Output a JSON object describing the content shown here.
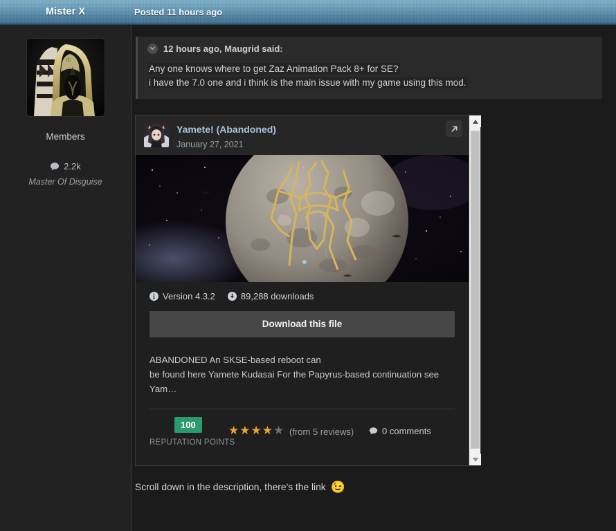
{
  "header": {
    "author": "Mister X",
    "posted": "Posted 11 hours ago"
  },
  "sidebar": {
    "avatar_alt": "hooded-figure-avatar",
    "group": "Members",
    "post_count": "2.2k",
    "post_count_icon": "comment-icon",
    "user_title": "Master Of Disguise"
  },
  "quote": {
    "collapse_icon": "chevron-down-circle-icon",
    "attribution": "12 hours ago, Maugrid said:",
    "line1": "Any one knows where to get Zaz Animation Pack 8+ for SE?",
    "line2": "i have the 7.0 one and i think is the main issue with my game using this mod."
  },
  "embed": {
    "avatar_alt": "anime-character-avatar",
    "title": "Yamete! (Abandoned)",
    "date": "January 27, 2021",
    "external_icon": "external-link-icon",
    "image_alt": "moon-with-gold-line-art",
    "info_icon": "info-circle-icon",
    "version": "Version 4.3.2",
    "download_icon": "download-circle-icon",
    "downloads": "89,288 downloads",
    "download_button": "Download this file",
    "description_line1": "ABANDONED   An SKSE-based reboot can",
    "description_line2": "be found here Yamete Kudasai For the Papyrus-based continuation see Yam…",
    "reputation_points": "100",
    "reputation_label": "REPUTATION POINTS",
    "stars_filled": 4,
    "stars_total": 5,
    "reviews": "(from 5 reviews)",
    "comments_icon": "comment-icon",
    "comments": "0 comments",
    "scrollbar_up_icon": "triangle-up-icon",
    "scrollbar_down_icon": "triangle-down-icon"
  },
  "post": {
    "tail_text": "Scroll down in the description, there's the link",
    "tail_emoji": "😉"
  },
  "colors": {
    "page_bg": "#1b1b1b",
    "sidebar_bg": "#222222",
    "header_blue": "#6ba1bd",
    "accent_link": "#a9c3dd",
    "reputation_green": "#2a9b6d",
    "star_gold": "#f0a22e",
    "button_gray": "#474747"
  }
}
